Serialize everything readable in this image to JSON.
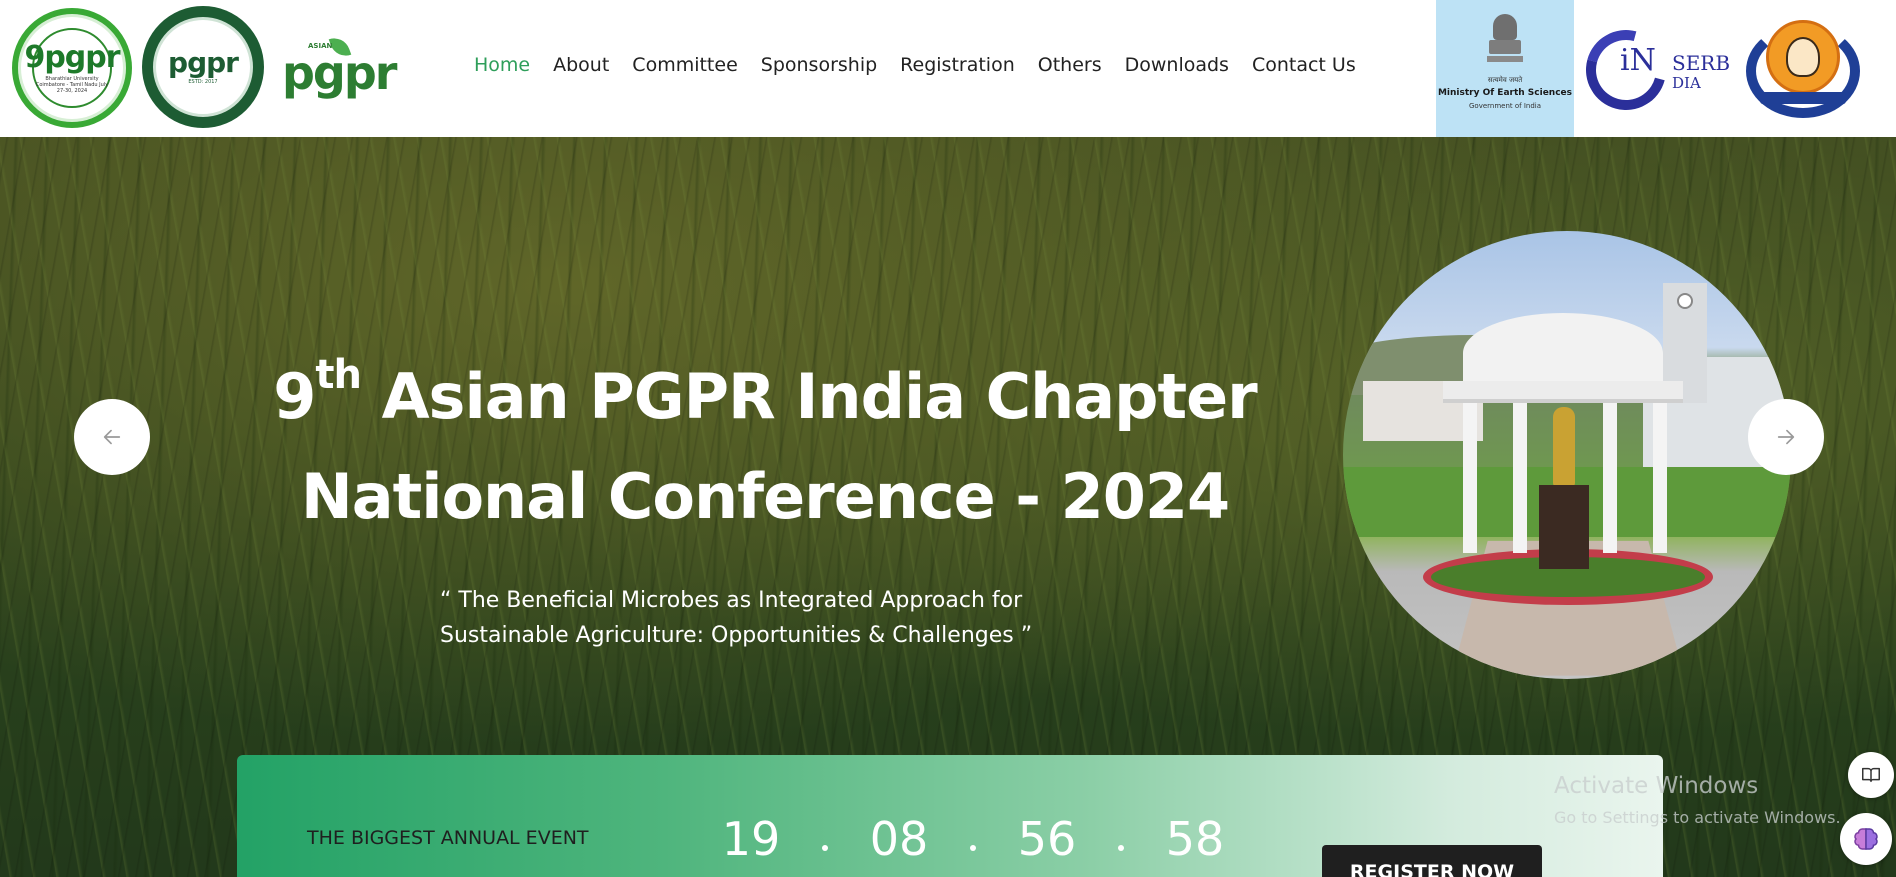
{
  "logos": {
    "conference_logo_text": "9pgpr",
    "conference_logo_small": "Bharathiar University Coimbatore - Tamil Nadu July 27-30, 2024",
    "society_logo_text": "pgpr",
    "society_logo_est": "ESTD: 2017",
    "pgpr_logo_text": "pgpr",
    "pgpr_logo_small": "ASIAN",
    "sponsor_moes_hindi": "सत्यमेव जयते",
    "sponsor_moes_title": "Ministry Of Earth Sciences",
    "sponsor_moes_sub": "Government of India",
    "serb_text_main": "iN",
    "serb_text_right": "SERB",
    "serb_text_sub": "DIA"
  },
  "nav": {
    "items": [
      {
        "label": "Home",
        "active": true
      },
      {
        "label": "About",
        "active": false
      },
      {
        "label": "Committee",
        "active": false
      },
      {
        "label": "Sponsorship",
        "active": false
      },
      {
        "label": "Registration",
        "active": false
      },
      {
        "label": "Others",
        "active": false
      },
      {
        "label": "Downloads",
        "active": false
      },
      {
        "label": "Contact Us",
        "active": false
      }
    ]
  },
  "hero": {
    "title_number": "9",
    "title_suffix": "th",
    "title_line1_rest": " Asian PGPR India Chapter",
    "title_line2": "National Conference - 2024",
    "subtitle_line1": "“ The Beneficial Microbes as Integrated Approach for",
    "subtitle_line2": "Sustainable Agriculture: Opportunities & Challenges ”",
    "prev_icon": "arrow-left-icon",
    "next_icon": "arrow-right-icon"
  },
  "countdown": {
    "label": "THE BIGGEST ANNUAL EVENT",
    "days": "19",
    "hours": "08",
    "minutes": "56",
    "seconds": "58",
    "register_label": "REGISTER NOW"
  },
  "watermark": {
    "line1": "Activate Windows",
    "line2": "Go to Settings to activate Windows."
  },
  "colors": {
    "nav_active": "#2e9e5a",
    "countdown_start": "#23a266",
    "register_button": "#1f1f1f"
  }
}
